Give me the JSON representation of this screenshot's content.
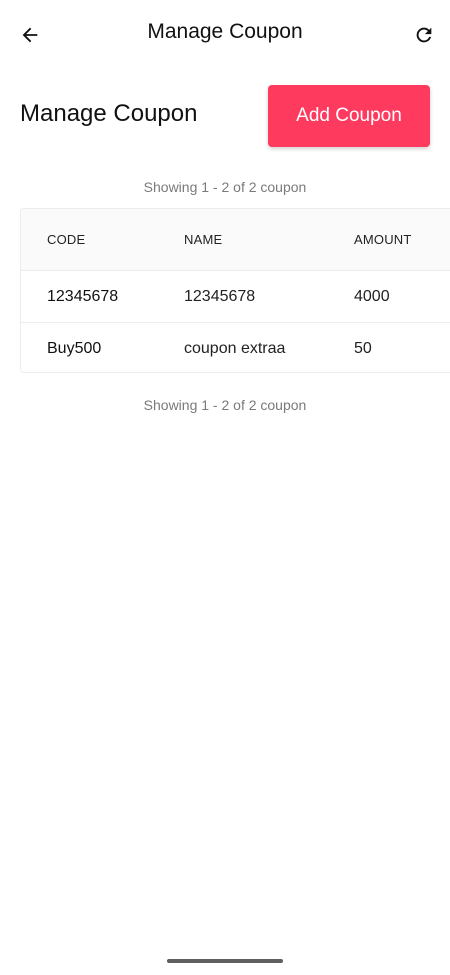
{
  "appbar": {
    "title": "Manage Coupon",
    "back_icon": "arrow-left-icon",
    "refresh_icon": "refresh-icon"
  },
  "page": {
    "heading": "Manage Coupon",
    "add_button_label": "Add Coupon",
    "accent_color": "#ff3a5f"
  },
  "summary": {
    "top": "Showing 1 - 2 of 2 coupon",
    "bottom": "Showing 1 - 2 of 2 coupon"
  },
  "table": {
    "columns": [
      "CODE",
      "NAME",
      "AMOUNT"
    ],
    "rows": [
      {
        "code": "12345678",
        "name": "12345678",
        "amount": "4000"
      },
      {
        "code": "Buy500",
        "name": "coupon extraa",
        "amount": "50"
      }
    ]
  }
}
